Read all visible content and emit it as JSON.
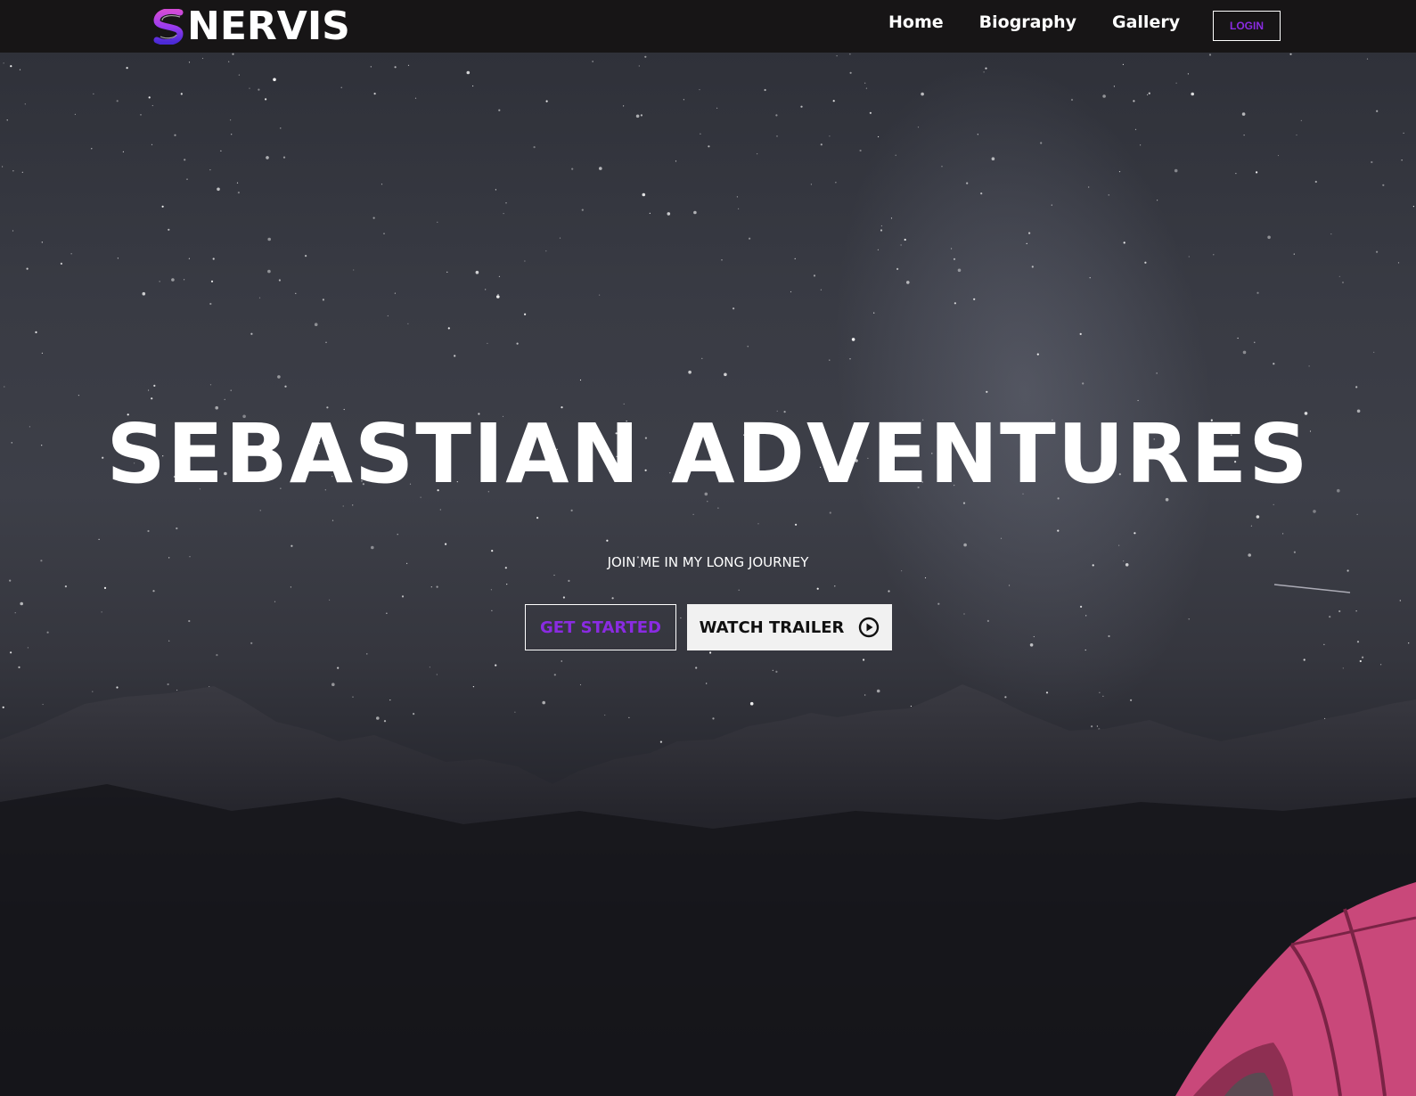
{
  "brand": {
    "name": "NERVIS",
    "logo_icon": "s-swirl-logo-icon",
    "accent_color": "#8a2be2"
  },
  "nav": {
    "items": [
      {
        "label": "Home"
      },
      {
        "label": "Biography"
      },
      {
        "label": "Gallery"
      }
    ],
    "login_label": "LOGIN"
  },
  "hero": {
    "title": "SEBASTIAN ADVENTURES",
    "subtitle": "JOIN ME IN MY LONG JOURNEY",
    "get_started_label": "GET STARTED",
    "watch_trailer_label": "WATCH TRAILER",
    "watch_trailer_icon": "play-circle-icon",
    "background": "night-sky-mountains-tent-image"
  }
}
